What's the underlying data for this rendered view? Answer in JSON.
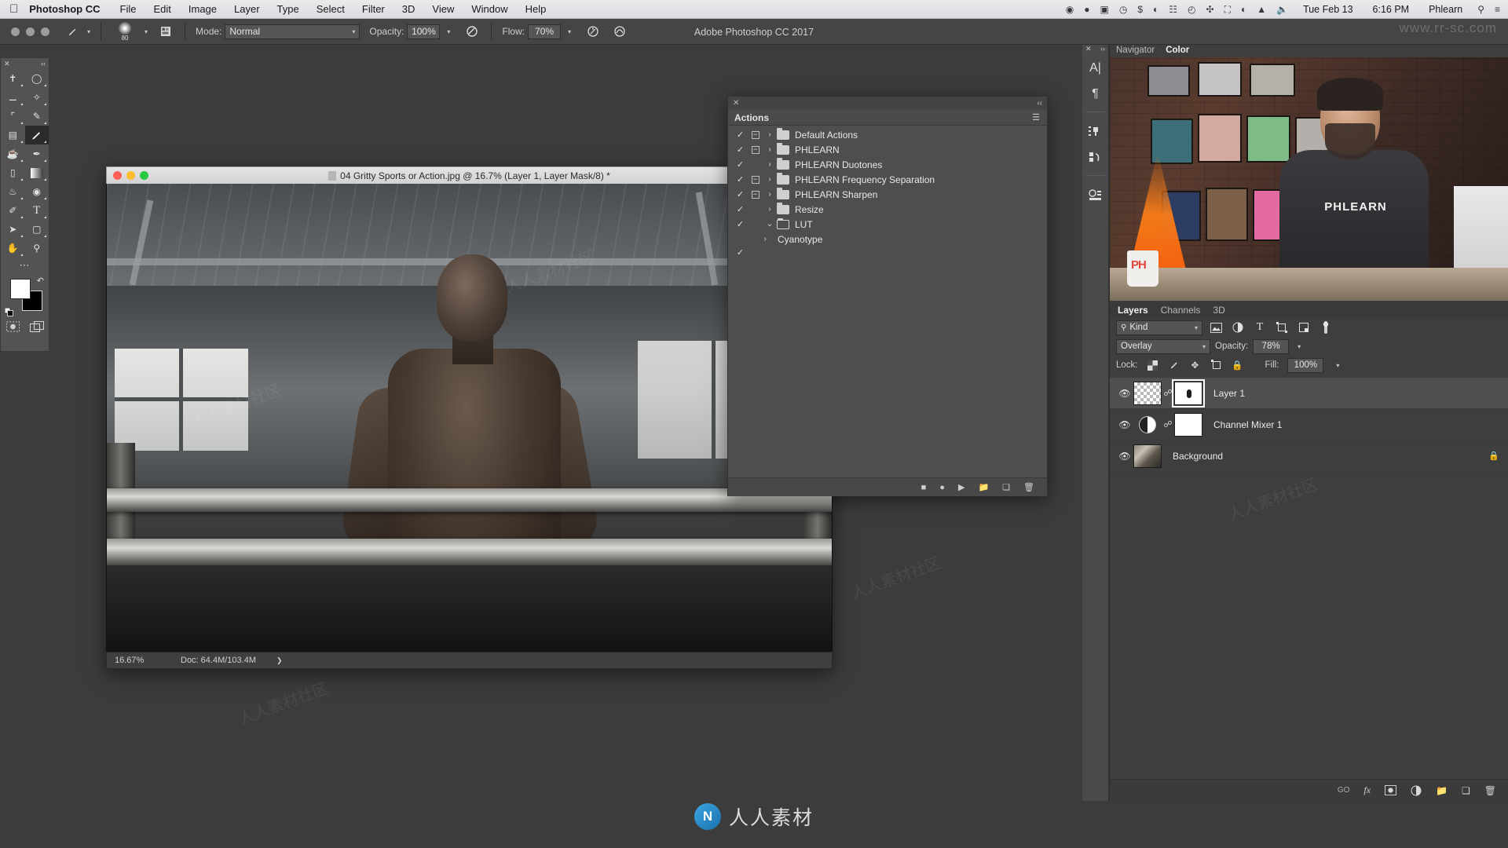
{
  "menubar": {
    "apple_icon": "apple-icon",
    "app_name": "Photoshop CC",
    "items": [
      "File",
      "Edit",
      "Image",
      "Layer",
      "Type",
      "Select",
      "Filter",
      "3D",
      "View",
      "Window",
      "Help"
    ],
    "status_icons": [
      "dropbox-icon",
      "screen-record-icon",
      "display-icon",
      "time-machine-icon",
      "dollar-icon",
      "battery-icon",
      "grid-icon",
      "clock-icon",
      "bluetooth-icon",
      "airplay-icon",
      "wifi-icon",
      "eject-icon",
      "volume-icon"
    ],
    "date": "Tue Feb 13",
    "time": "6:16 PM",
    "user": "Phlearn",
    "search_icon": "search-icon",
    "control_center_icon": "list-icon"
  },
  "app_title": "Adobe Photoshop CC 2017",
  "options_bar": {
    "tool_icon": "brush-icon",
    "brush_size": "80",
    "brush_settings_icon": "brush-settings-icon",
    "mode_label": "Mode:",
    "mode_value": "Normal",
    "opacity_label": "Opacity:",
    "opacity_value": "100%",
    "pressure_opacity_icon": "pressure-opacity-icon",
    "flow_label": "Flow:",
    "flow_value": "70%",
    "airbrush_icon": "airbrush-icon",
    "smoothing_icon": "smoothing-icon"
  },
  "toolbox": {
    "close_icon": "close-icon",
    "collapse_icon": "collapse-icon",
    "tools": [
      {
        "name": "move-tool",
        "glyph": "✥"
      },
      {
        "name": "elliptical-marquee-tool",
        "glyph": "◯"
      },
      {
        "name": "lasso-tool",
        "glyph": "♄"
      },
      {
        "name": "magic-wand-tool",
        "glyph": "✦"
      },
      {
        "name": "crop-tool",
        "glyph": "⌗"
      },
      {
        "name": "eyedropper-tool",
        "glyph": "✎"
      },
      {
        "name": "spot-healing-brush-tool",
        "glyph": "✚"
      },
      {
        "name": "brush-tool",
        "glyph": "🖌"
      },
      {
        "name": "clone-stamp-tool",
        "glyph": "⎙"
      },
      {
        "name": "history-brush-tool",
        "glyph": "✐"
      },
      {
        "name": "eraser-tool",
        "glyph": "⌫"
      },
      {
        "name": "gradient-tool",
        "glyph": "▧"
      },
      {
        "name": "blur-tool",
        "glyph": "💧"
      },
      {
        "name": "dodge-tool",
        "glyph": "◍"
      },
      {
        "name": "pen-tool",
        "glyph": "✒"
      },
      {
        "name": "type-tool",
        "glyph": "T"
      },
      {
        "name": "path-selection-tool",
        "glyph": "➤"
      },
      {
        "name": "rectangle-tool",
        "glyph": "▢"
      },
      {
        "name": "hand-tool",
        "glyph": "✋"
      },
      {
        "name": "zoom-tool",
        "glyph": "⚲"
      }
    ],
    "more_tools_icon": "more-tools-icon",
    "foreground_color": "#ffffff",
    "background_color": "#000000",
    "swap_colors_icon": "swap-colors-icon",
    "default_colors_icon": "default-colors-icon",
    "quick_mask_icon": "quick-mask-icon",
    "screen_mode_icon": "screen-mode-icon"
  },
  "document": {
    "title": "04 Gritty Sports or Action.jpg @ 16.7% (Layer 1, Layer Mask/8) *",
    "file_icon": "document-icon",
    "traffic_lights": [
      "close-button",
      "minimize-button",
      "zoom-button"
    ],
    "status": {
      "zoom": "16.67%",
      "doc_size": "Doc: 64.4M/103.4M",
      "expand_icon": "chevron-right-icon"
    }
  },
  "actions_panel": {
    "close_icon": "close-icon",
    "collapse_icon": "collapse-icon",
    "tab_label": "Actions",
    "menu_icon": "panel-menu-icon",
    "rows": [
      {
        "label": "Default Actions",
        "checked": true,
        "toggle": "minus",
        "expanded": false,
        "child": false
      },
      {
        "label": "PHLEARN",
        "checked": true,
        "toggle": "minus",
        "expanded": false,
        "child": false
      },
      {
        "label": "PHLEARN Duotones",
        "checked": true,
        "toggle": "none",
        "expanded": false,
        "child": false
      },
      {
        "label": "PHLEARN Frequency Separation",
        "checked": true,
        "toggle": "minus",
        "expanded": false,
        "child": false
      },
      {
        "label": "PHLEARN Sharpen",
        "checked": true,
        "toggle": "minus",
        "expanded": false,
        "child": false
      },
      {
        "label": "Resize",
        "checked": true,
        "toggle": "none",
        "expanded": false,
        "child": false
      },
      {
        "label": "LUT",
        "checked": true,
        "toggle": "none",
        "expanded": true,
        "child": false
      },
      {
        "label": "Cyanotype",
        "checked": true,
        "toggle": "none",
        "expanded": false,
        "child": true
      }
    ],
    "footer_icons": [
      "stop-icon",
      "record-icon",
      "play-icon",
      "new-set-icon",
      "new-action-icon",
      "delete-icon"
    ]
  },
  "mini_dock": {
    "close_icon": "close-icon",
    "expand_icon": "expand-icon",
    "icons": [
      "character-icon",
      "paragraph-icon",
      "layer-comps-icon",
      "history-icon",
      "info-icon"
    ]
  },
  "navigator_panel": {
    "tabs": [
      {
        "label": "Navigator",
        "active": false
      },
      {
        "label": "Color",
        "active": true
      }
    ]
  },
  "layers_panel": {
    "tabs": [
      {
        "label": "Layers",
        "active": true
      },
      {
        "label": "Channels",
        "active": false
      },
      {
        "label": "3D",
        "active": false
      }
    ],
    "filter": {
      "search_icon": "search-icon",
      "kind_label": "Kind",
      "chevron_icon": "chevron-down-icon",
      "filter_icons": [
        "pixel-filter-icon",
        "adjustment-filter-icon",
        "type-filter-icon",
        "shape-filter-icon",
        "smart-object-filter-icon"
      ],
      "toggle_icon": "filter-toggle-icon"
    },
    "blend_mode": "Overlay",
    "opacity_label": "Opacity:",
    "opacity_value": "78%",
    "lock_label": "Lock:",
    "lock_icons": [
      "lock-transparency-icon",
      "lock-image-icon",
      "lock-position-icon",
      "lock-artboard-icon",
      "lock-all-icon"
    ],
    "fill_label": "Fill:",
    "fill_value": "100%",
    "layers": [
      {
        "name": "Layer 1",
        "visible": true,
        "type": "pixel",
        "has_mask": true,
        "mask_selected": true,
        "linked": true,
        "selected": true,
        "locked": false
      },
      {
        "name": "Channel Mixer 1",
        "visible": true,
        "type": "adjustment",
        "has_mask": true,
        "mask_selected": false,
        "linked": true,
        "selected": false,
        "locked": false
      },
      {
        "name": "Background",
        "visible": true,
        "type": "image",
        "has_mask": false,
        "mask_selected": false,
        "linked": false,
        "selected": false,
        "locked": true
      }
    ],
    "footer": {
      "link_label": "GO",
      "fx_label": "fx",
      "icons": [
        "add-mask-icon",
        "new-adjustment-icon",
        "new-group-icon",
        "new-layer-icon",
        "delete-layer-icon"
      ]
    }
  },
  "watermark": {
    "logo_letter": "N",
    "text": "人人素材",
    "url": "www.rr-sc.com"
  }
}
